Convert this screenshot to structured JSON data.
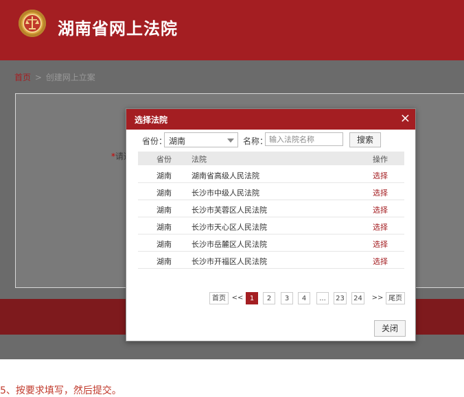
{
  "header": {
    "title": "湖南省网上法院"
  },
  "breadcrumb": {
    "home": "首页",
    "separator": ">",
    "current": "创建网上立案"
  },
  "form": {
    "required_label_fragment": "请选"
  },
  "dialog": {
    "title": "选择法院",
    "close_glyph": "×",
    "province_label": "省份：",
    "province_value": "湖南",
    "name_label": "名称：",
    "name_placeholder": "输入法院名称",
    "search_label": "搜索",
    "columns": [
      "省份",
      "法院",
      "操作"
    ],
    "rows": [
      {
        "province": "湖南",
        "court": "湖南省高级人民法院",
        "action": "选择"
      },
      {
        "province": "湖南",
        "court": "长沙市中级人民法院",
        "action": "选择"
      },
      {
        "province": "湖南",
        "court": "长沙市芙蓉区人民法院",
        "action": "选择"
      },
      {
        "province": "湖南",
        "court": "长沙市天心区人民法院",
        "action": "选择"
      },
      {
        "province": "湖南",
        "court": "长沙市岳麓区人民法院",
        "action": "选择"
      },
      {
        "province": "湖南",
        "court": "长沙市开福区人民法院",
        "action": "选择"
      }
    ],
    "pagination": {
      "first": "首页",
      "prev": "<<",
      "pages": [
        "1",
        "2",
        "3",
        "4",
        "...",
        "23",
        "24"
      ],
      "current": "1",
      "next": ">>",
      "last": "尾页"
    },
    "close_label": "关闭"
  },
  "caption": "5、按要求填写，然后提交。",
  "colors": {
    "brand": "#a41e22",
    "overlay": "#6b6b6b"
  }
}
